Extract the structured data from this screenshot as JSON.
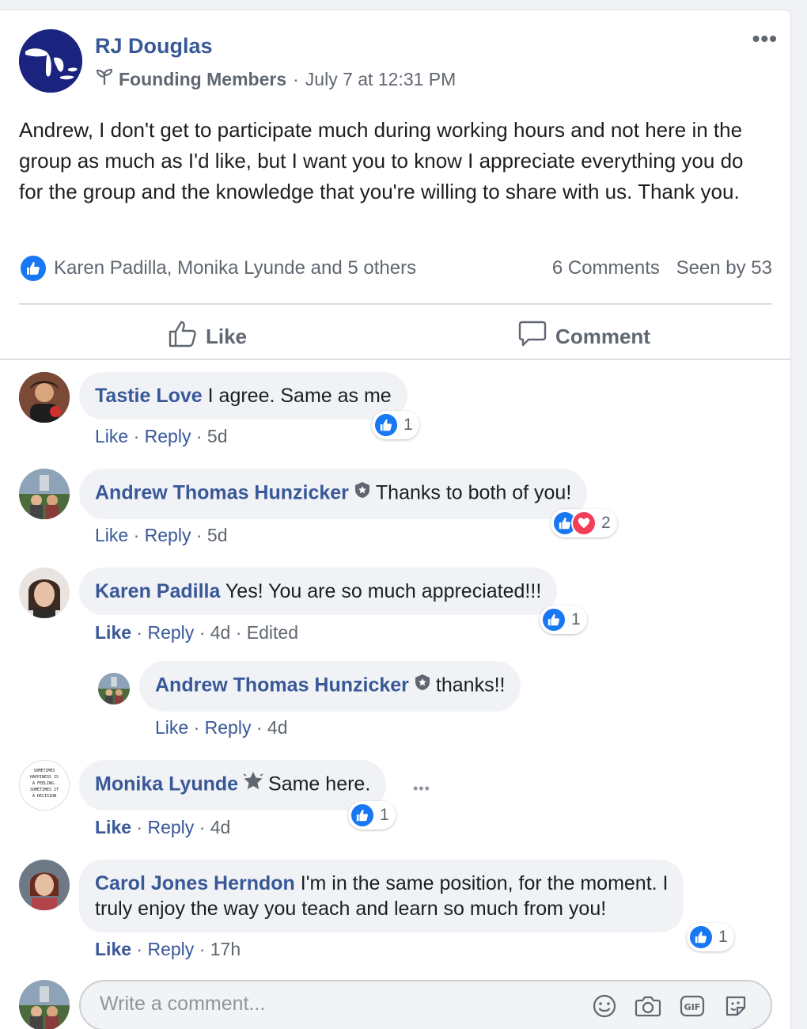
{
  "post": {
    "author": "RJ Douglas",
    "group_badge": "Founding Members",
    "separator": "·",
    "timestamp": "July 7 at 12:31 PM",
    "more": "•••",
    "text": "Andrew, I don't get to participate much during working hours and not here in the group as much as I'd like, but I want you to know I appreciate everything you do for the group and the knowledge that you're willing to share with us. Thank you.",
    "reactions_names": "Karen Padilla, Monika Lyunde and 5 others",
    "comments_count": "6 Comments",
    "seen_by": "Seen by 53",
    "like_label": "Like",
    "comment_label": "Comment"
  },
  "comments": [
    {
      "name": "Tastie Love",
      "text": "I agree. Same as me",
      "like": "Like",
      "reply": "Reply",
      "time": "5d",
      "reaction_count": "1"
    },
    {
      "name": "Andrew Thomas Hunzicker",
      "text": "Thanks to both of you!",
      "like": "Like",
      "reply": "Reply",
      "time": "5d",
      "reaction_count": "2"
    },
    {
      "name": "Karen Padilla",
      "text": "Yes! You are so much appreciated!!!",
      "like": "Like",
      "reply": "Reply",
      "time": "4d",
      "edited": "Edited",
      "reaction_count": "1"
    },
    {
      "name": "Andrew Thomas Hunzicker",
      "text": "thanks!!",
      "like": "Like",
      "reply": "Reply",
      "time": "4d"
    },
    {
      "name": "Monika Lyunde",
      "text": "Same here.",
      "like": "Like",
      "reply": "Reply",
      "time": "4d",
      "reaction_count": "1",
      "more": "•••"
    },
    {
      "name": "Carol Jones Herndon",
      "text_line1": "I'm in the same position, for the moment. I",
      "text_line2": "truly enjoy the way you teach and learn so much from you!",
      "like": "Like",
      "reply": "Reply",
      "time": "17h",
      "reaction_count": "1"
    }
  ],
  "dot": "·",
  "composer": {
    "placeholder": "Write a comment..."
  },
  "icons": {
    "like": "thumbs-up-icon",
    "love": "heart-icon",
    "admin": "shield-star-icon",
    "rising": "star-icon",
    "founding": "sprout-icon",
    "emoji": "smiley-icon",
    "camera": "camera-icon",
    "gif": "gif-icon",
    "sticker": "sticker-icon"
  },
  "colors": {
    "link": "#385898",
    "like_blue": "#1877f2",
    "love_red": "#f33e58",
    "muted": "#606770"
  }
}
